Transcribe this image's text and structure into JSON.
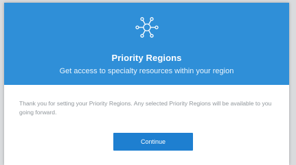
{
  "modal": {
    "title": "Priority Regions",
    "subtitle": "Get access to specialty resources within your region",
    "icon": "network-hub-icon",
    "body_text": "Thank you for setting your Priority Regions. Any selected Priority Regions will be available to you going forward.",
    "continue_label": "Continue"
  },
  "colors": {
    "header_bg": "#2f8fd8",
    "button_bg": "#1e7fd0",
    "body_text": "#8f959a"
  }
}
